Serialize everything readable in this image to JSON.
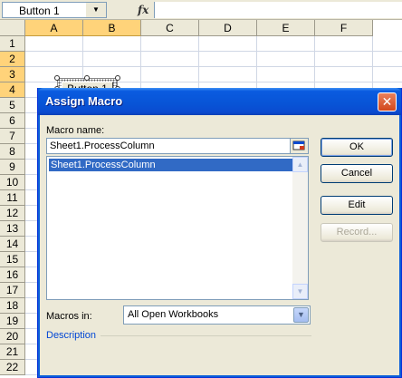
{
  "formula_bar": {
    "name_box": "Button 1",
    "fx": "fx",
    "formula": ""
  },
  "sheet": {
    "columns": [
      "A",
      "B",
      "C",
      "D",
      "E",
      "F"
    ],
    "rows": [
      "1",
      "2",
      "3",
      "4",
      "5",
      "6",
      "7",
      "8",
      "9",
      "10",
      "11",
      "12",
      "13",
      "14",
      "15",
      "16",
      "17",
      "18",
      "19",
      "20",
      "21",
      "22"
    ],
    "button_label": "Button 1"
  },
  "dialog": {
    "title": "Assign Macro",
    "close": "✕",
    "macro_name_label": "Macro name:",
    "macro_name_value": "Sheet1.ProcessColumn",
    "macro_list": [
      "Sheet1.ProcessColumn"
    ],
    "macros_in_label": "Macros in:",
    "macros_in_value": "All Open Workbooks",
    "description_label": "Description",
    "buttons": {
      "ok": "OK",
      "cancel": "Cancel",
      "edit": "Edit",
      "record": "Record..."
    }
  }
}
